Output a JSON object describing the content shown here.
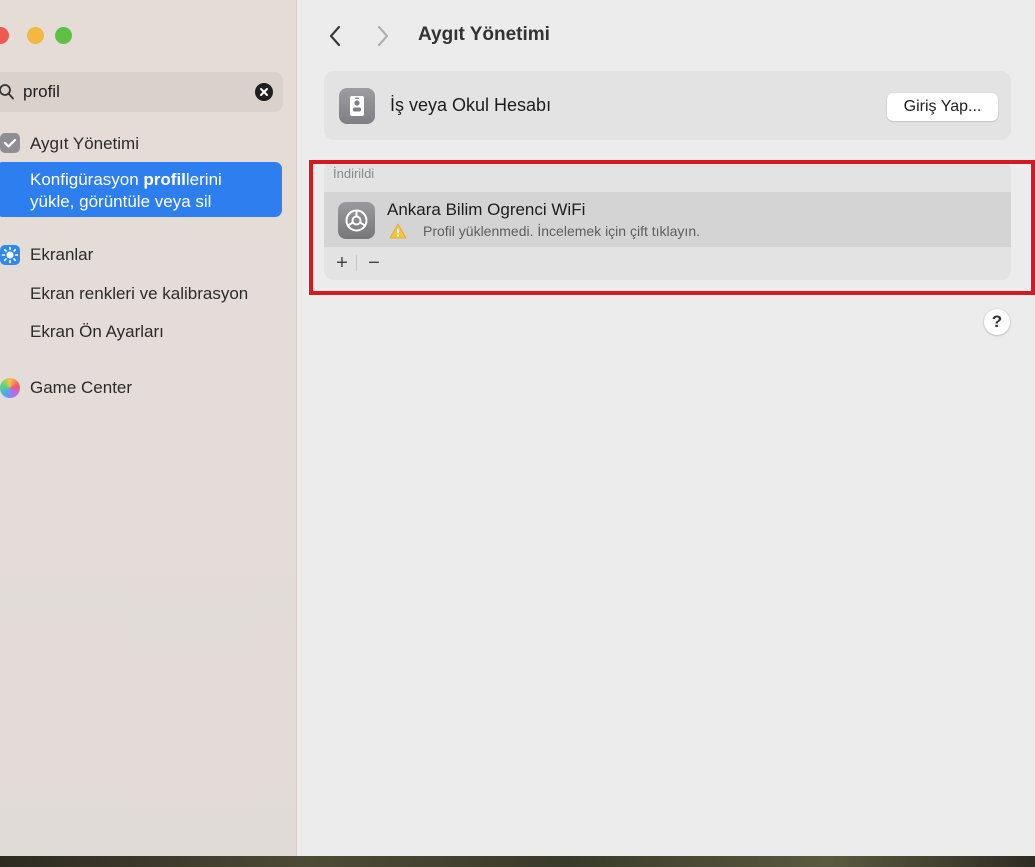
{
  "sidebar": {
    "search": {
      "value": "profil"
    },
    "items": [
      {
        "label": "Aygıt Yönetimi",
        "icon": "device-management-icon"
      },
      {
        "line1_pre": "Konfigürasyon ",
        "line1_bold": "profil",
        "line1_post": "lerini",
        "line2": "yükle, görüntüle veya sil",
        "selected": true
      },
      {
        "label": "Ekranlar",
        "icon": "sun-icon"
      },
      {
        "label": "Ekran renkleri ve kalibrasyon"
      },
      {
        "label": "Ekran Ön Ayarları"
      },
      {
        "label": "Game Center",
        "icon": "game-center-icon"
      }
    ]
  },
  "header": {
    "title": "Aygıt Yönetimi"
  },
  "account": {
    "label": "İş veya Okul Hesabı",
    "button": "Giriş Yap..."
  },
  "installed": {
    "header": "İndirildi",
    "profiles": [
      {
        "name": "Ankara Bilim Ogrenci WiFi",
        "status": "Profil yüklenmedi. İncelemek için çift tıklayın."
      }
    ],
    "add_label": "+",
    "remove_label": "−"
  },
  "help_label": "?",
  "colors": {
    "accent": "#2d7ff0",
    "highlight_box": "#d51921",
    "warning": "#f5c242"
  }
}
